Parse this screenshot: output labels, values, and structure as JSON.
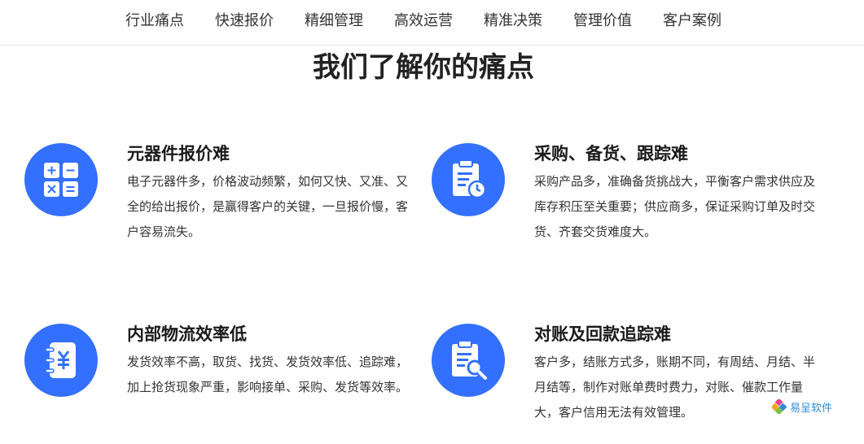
{
  "nav": {
    "items": [
      "行业痛点",
      "快速报价",
      "精细管理",
      "高效运营",
      "精准决策",
      "管理价值",
      "客户案例"
    ]
  },
  "section": {
    "title": "我们了解你的痛点"
  },
  "cards": [
    {
      "title": "元器件报价难",
      "desc": "电子元器件多，价格波动频繁，如何又快、又准、又全的给出报价，是赢得客户的关键，一旦报价慢，客户容易流失。",
      "icon": "calculator-icon"
    },
    {
      "title": "采购、备货、跟踪难",
      "desc": "采购产品多，准确备货挑战大，平衡客户需求供应及库存积压至关重要；供应商多，保证采购订单及时交货、齐套交货难度大。",
      "icon": "clipboard-clock-icon"
    },
    {
      "title": "内部物流效率低",
      "desc": "发货效率不高，取货、找货、发货效率低、追踪难，加上抢货现象严重，影响接单、采购、发货等效率。",
      "icon": "yen-notebook-icon"
    },
    {
      "title": "对账及回款追踪难",
      "desc": "客户多，结账方式多，账期不同，有周结、月结、半月结等，制作对账单费时费力，对账、催款工作量大，客户信用无法有效管理。",
      "icon": "clipboard-search-icon"
    }
  ],
  "watermark": {
    "text": "易呈软件"
  },
  "colors": {
    "accent": "#3370ff",
    "title": "#222222",
    "text": "#333333",
    "watermark": "#2e8bd8"
  }
}
